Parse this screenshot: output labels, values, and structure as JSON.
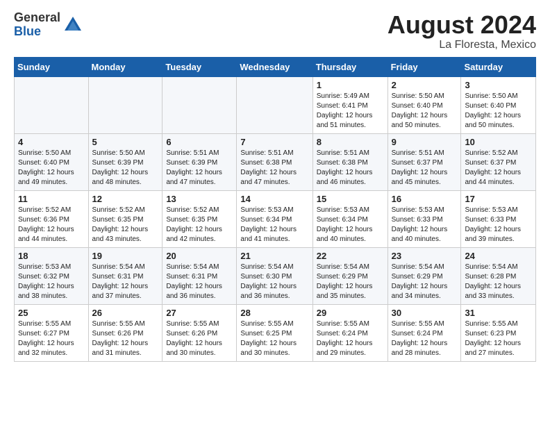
{
  "logo": {
    "general": "General",
    "blue": "Blue"
  },
  "title": {
    "month_year": "August 2024",
    "location": "La Floresta, Mexico"
  },
  "weekdays": [
    "Sunday",
    "Monday",
    "Tuesday",
    "Wednesday",
    "Thursday",
    "Friday",
    "Saturday"
  ],
  "weeks": [
    [
      {
        "day": "",
        "sunrise": "",
        "sunset": "",
        "daylight": ""
      },
      {
        "day": "",
        "sunrise": "",
        "sunset": "",
        "daylight": ""
      },
      {
        "day": "",
        "sunrise": "",
        "sunset": "",
        "daylight": ""
      },
      {
        "day": "",
        "sunrise": "",
        "sunset": "",
        "daylight": ""
      },
      {
        "day": "1",
        "sunrise": "Sunrise: 5:49 AM",
        "sunset": "Sunset: 6:41 PM",
        "daylight": "Daylight: 12 hours and 51 minutes."
      },
      {
        "day": "2",
        "sunrise": "Sunrise: 5:50 AM",
        "sunset": "Sunset: 6:40 PM",
        "daylight": "Daylight: 12 hours and 50 minutes."
      },
      {
        "day": "3",
        "sunrise": "Sunrise: 5:50 AM",
        "sunset": "Sunset: 6:40 PM",
        "daylight": "Daylight: 12 hours and 50 minutes."
      }
    ],
    [
      {
        "day": "4",
        "sunrise": "Sunrise: 5:50 AM",
        "sunset": "Sunset: 6:40 PM",
        "daylight": "Daylight: 12 hours and 49 minutes."
      },
      {
        "day": "5",
        "sunrise": "Sunrise: 5:50 AM",
        "sunset": "Sunset: 6:39 PM",
        "daylight": "Daylight: 12 hours and 48 minutes."
      },
      {
        "day": "6",
        "sunrise": "Sunrise: 5:51 AM",
        "sunset": "Sunset: 6:39 PM",
        "daylight": "Daylight: 12 hours and 47 minutes."
      },
      {
        "day": "7",
        "sunrise": "Sunrise: 5:51 AM",
        "sunset": "Sunset: 6:38 PM",
        "daylight": "Daylight: 12 hours and 47 minutes."
      },
      {
        "day": "8",
        "sunrise": "Sunrise: 5:51 AM",
        "sunset": "Sunset: 6:38 PM",
        "daylight": "Daylight: 12 hours and 46 minutes."
      },
      {
        "day": "9",
        "sunrise": "Sunrise: 5:51 AM",
        "sunset": "Sunset: 6:37 PM",
        "daylight": "Daylight: 12 hours and 45 minutes."
      },
      {
        "day": "10",
        "sunrise": "Sunrise: 5:52 AM",
        "sunset": "Sunset: 6:37 PM",
        "daylight": "Daylight: 12 hours and 44 minutes."
      }
    ],
    [
      {
        "day": "11",
        "sunrise": "Sunrise: 5:52 AM",
        "sunset": "Sunset: 6:36 PM",
        "daylight": "Daylight: 12 hours and 44 minutes."
      },
      {
        "day": "12",
        "sunrise": "Sunrise: 5:52 AM",
        "sunset": "Sunset: 6:35 PM",
        "daylight": "Daylight: 12 hours and 43 minutes."
      },
      {
        "day": "13",
        "sunrise": "Sunrise: 5:52 AM",
        "sunset": "Sunset: 6:35 PM",
        "daylight": "Daylight: 12 hours and 42 minutes."
      },
      {
        "day": "14",
        "sunrise": "Sunrise: 5:53 AM",
        "sunset": "Sunset: 6:34 PM",
        "daylight": "Daylight: 12 hours and 41 minutes."
      },
      {
        "day": "15",
        "sunrise": "Sunrise: 5:53 AM",
        "sunset": "Sunset: 6:34 PM",
        "daylight": "Daylight: 12 hours and 40 minutes."
      },
      {
        "day": "16",
        "sunrise": "Sunrise: 5:53 AM",
        "sunset": "Sunset: 6:33 PM",
        "daylight": "Daylight: 12 hours and 40 minutes."
      },
      {
        "day": "17",
        "sunrise": "Sunrise: 5:53 AM",
        "sunset": "Sunset: 6:33 PM",
        "daylight": "Daylight: 12 hours and 39 minutes."
      }
    ],
    [
      {
        "day": "18",
        "sunrise": "Sunrise: 5:53 AM",
        "sunset": "Sunset: 6:32 PM",
        "daylight": "Daylight: 12 hours and 38 minutes."
      },
      {
        "day": "19",
        "sunrise": "Sunrise: 5:54 AM",
        "sunset": "Sunset: 6:31 PM",
        "daylight": "Daylight: 12 hours and 37 minutes."
      },
      {
        "day": "20",
        "sunrise": "Sunrise: 5:54 AM",
        "sunset": "Sunset: 6:31 PM",
        "daylight": "Daylight: 12 hours and 36 minutes."
      },
      {
        "day": "21",
        "sunrise": "Sunrise: 5:54 AM",
        "sunset": "Sunset: 6:30 PM",
        "daylight": "Daylight: 12 hours and 36 minutes."
      },
      {
        "day": "22",
        "sunrise": "Sunrise: 5:54 AM",
        "sunset": "Sunset: 6:29 PM",
        "daylight": "Daylight: 12 hours and 35 minutes."
      },
      {
        "day": "23",
        "sunrise": "Sunrise: 5:54 AM",
        "sunset": "Sunset: 6:29 PM",
        "daylight": "Daylight: 12 hours and 34 minutes."
      },
      {
        "day": "24",
        "sunrise": "Sunrise: 5:54 AM",
        "sunset": "Sunset: 6:28 PM",
        "daylight": "Daylight: 12 hours and 33 minutes."
      }
    ],
    [
      {
        "day": "25",
        "sunrise": "Sunrise: 5:55 AM",
        "sunset": "Sunset: 6:27 PM",
        "daylight": "Daylight: 12 hours and 32 minutes."
      },
      {
        "day": "26",
        "sunrise": "Sunrise: 5:55 AM",
        "sunset": "Sunset: 6:26 PM",
        "daylight": "Daylight: 12 hours and 31 minutes."
      },
      {
        "day": "27",
        "sunrise": "Sunrise: 5:55 AM",
        "sunset": "Sunset: 6:26 PM",
        "daylight": "Daylight: 12 hours and 30 minutes."
      },
      {
        "day": "28",
        "sunrise": "Sunrise: 5:55 AM",
        "sunset": "Sunset: 6:25 PM",
        "daylight": "Daylight: 12 hours and 30 minutes."
      },
      {
        "day": "29",
        "sunrise": "Sunrise: 5:55 AM",
        "sunset": "Sunset: 6:24 PM",
        "daylight": "Daylight: 12 hours and 29 minutes."
      },
      {
        "day": "30",
        "sunrise": "Sunrise: 5:55 AM",
        "sunset": "Sunset: 6:24 PM",
        "daylight": "Daylight: 12 hours and 28 minutes."
      },
      {
        "day": "31",
        "sunrise": "Sunrise: 5:55 AM",
        "sunset": "Sunset: 6:23 PM",
        "daylight": "Daylight: 12 hours and 27 minutes."
      }
    ]
  ]
}
